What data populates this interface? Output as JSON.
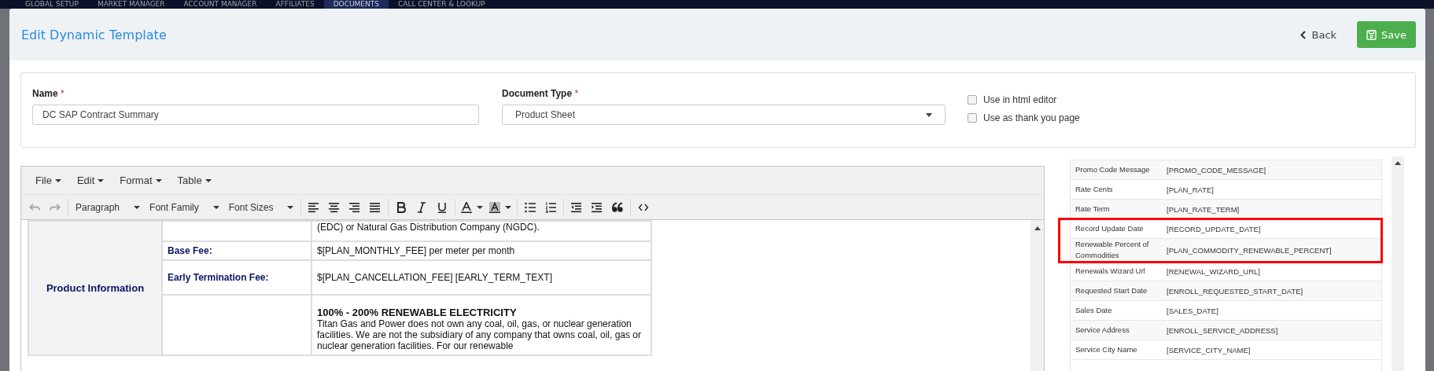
{
  "nav": {
    "items": [
      {
        "label": "GLOBAL SETUP",
        "selected": false
      },
      {
        "label": "MARKET MANAGER",
        "selected": false
      },
      {
        "label": "ACCOUNT MANAGER",
        "selected": false
      },
      {
        "label": "AFFILIATES",
        "selected": false
      },
      {
        "label": "DOCUMENTS",
        "selected": true
      },
      {
        "label": "CALL CENTER & LOOKUP",
        "selected": false
      }
    ]
  },
  "window": {
    "title": "Edit Dynamic Template",
    "back": "Back",
    "save": "Save"
  },
  "form": {
    "name": {
      "label": "Name",
      "required_mark": "*",
      "value": "DC SAP Contract Summary"
    },
    "document_type": {
      "label": "Document Type",
      "required_mark": "*",
      "value": "Product Sheet"
    },
    "options": [
      {
        "label": "Use in html editor",
        "checked": false
      },
      {
        "label": "Use as thank you page",
        "checked": false
      }
    ]
  },
  "editor": {
    "menus": [
      "File",
      "Edit",
      "Format",
      "Table"
    ],
    "toolbar": [
      {
        "kind": "undo",
        "disabled": true
      },
      {
        "kind": "redo",
        "disabled": true
      },
      {
        "kind": "sep"
      },
      {
        "kind": "dropdown",
        "label": "Paragraph"
      },
      {
        "kind": "dropdown",
        "label": "Font Family"
      },
      {
        "kind": "dropdown",
        "label": "Font Sizes"
      },
      {
        "kind": "sep"
      },
      {
        "kind": "align-left"
      },
      {
        "kind": "align-center"
      },
      {
        "kind": "align-right"
      },
      {
        "kind": "justify"
      },
      {
        "kind": "sep"
      },
      {
        "kind": "bold"
      },
      {
        "kind": "italic"
      },
      {
        "kind": "underline"
      },
      {
        "kind": "sep"
      },
      {
        "kind": "text-color"
      },
      {
        "kind": "bg-color"
      },
      {
        "kind": "sep"
      },
      {
        "kind": "bullets"
      },
      {
        "kind": "numbers"
      },
      {
        "kind": "sep"
      },
      {
        "kind": "outdent"
      },
      {
        "kind": "indent"
      },
      {
        "kind": "quote"
      },
      {
        "kind": "sep"
      },
      {
        "kind": "code"
      }
    ],
    "section": "Product Information",
    "rows": [
      {
        "label": "",
        "value": "(EDC) or Natural Gas Distribution Company (NGDC)."
      },
      {
        "label": "Base Fee:",
        "value": "$[PLAN_MONTHLY_FEE] per meter per month"
      },
      {
        "label": "Early Termination Fee:",
        "value": "$[PLAN_CANCELLATION_FEE] [EARLY_TERM_TEXT]"
      },
      {
        "label": "",
        "heading": "100% - 200% RENEWABLE ELECTRICITY",
        "value": "Titan Gas and Power does not own any coal, oil, gas, or nuclear generation facilities. We are not the subsidiary of any company that owns coal, oil, gas or nuclear generation facilities. For our renewable"
      }
    ]
  },
  "fields": [
    {
      "name": "Promo Code Message",
      "token": "[PROMO_CODE_MESSAGE]",
      "highlighted": false
    },
    {
      "name": "Rate Cents",
      "token": "[PLAN_RATE]",
      "highlighted": false
    },
    {
      "name": "Rate Term",
      "token": "[PLAN_RATE_TERM]",
      "highlighted": false
    },
    {
      "name": "Record Update Date",
      "token": "[RECORD_UPDATE_DATE]",
      "highlighted": true
    },
    {
      "name": "Renewable Percent of Commodities",
      "token": "[PLAN_COMMODITY_RENEWABLE_PERCENT]",
      "highlighted": true
    },
    {
      "name": "Renewals Wizard Url",
      "token": "[RENEWAL_WIZARD_URL]",
      "highlighted": false
    },
    {
      "name": "Requested Start Date",
      "token": "[ENROLL_REQUESTED_START_DATE]",
      "highlighted": false
    },
    {
      "name": "Sales Date",
      "token": "[SALES_DATE]",
      "highlighted": false
    },
    {
      "name": "Service Address",
      "token": "[ENROLL_SERVICE_ADDRESS]",
      "highlighted": false
    },
    {
      "name": "Service City Name",
      "token": "[SERVICE_CITY_NAME]",
      "highlighted": false
    }
  ]
}
